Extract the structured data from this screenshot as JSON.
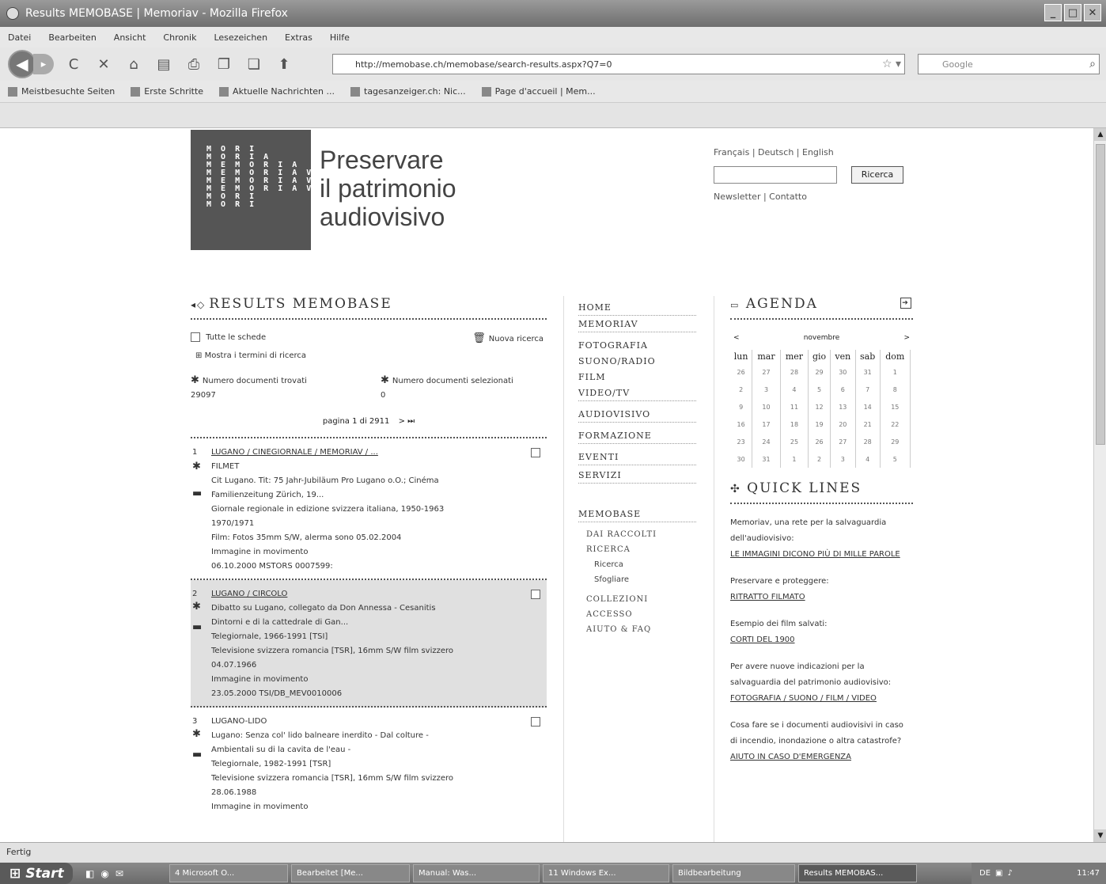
{
  "window": {
    "title": "Results MEMOBASE | Memoriav - Mozilla Firefox",
    "controls": [
      "_",
      "□",
      "✕"
    ]
  },
  "menubar": [
    "Datei",
    "Bearbeiten",
    "Ansicht",
    "Chronik",
    "Lesezeichen",
    "Extras",
    "Hilfe"
  ],
  "navbar": {
    "url": "http://memobase.ch/memobase/search-results.aspx?Q7=0",
    "search_placeholder": "Google"
  },
  "bookmarks": [
    {
      "label": "Meistbesuchte Seiten",
      "icon": "page-icon"
    },
    {
      "label": "Erste Schritte",
      "icon": "firefox-icon"
    },
    {
      "label": "Aktuelle Nachrichten ...",
      "icon": "rss-icon"
    },
    {
      "label": "tagesanzeiger.ch: Nic...",
      "icon": "c-icon"
    },
    {
      "label": "Page d'accueil | Mem...",
      "icon": "page-icon"
    }
  ],
  "header": {
    "logo_text": "M O R I\nM O R I A\nM E M O R I A\nM E M O R I A V\nM E M O R I A V\nM E M O R I A V\nM O R I\nM O R I",
    "tagline": [
      "Preservare",
      "il patrimonio",
      "audiovisivo"
    ],
    "languages": "Français | Deutsch | English",
    "search_button": "Ricerca",
    "links": "Newsletter | Contatto"
  },
  "results": {
    "heading": "RESULTS MEMOBASE",
    "select_all": "Tutte le schede",
    "new_search": "Nuova ricerca",
    "show_terms": "Mostra i termini di ricerca",
    "count_found_label": "Numero documenti trovati",
    "count_found": "29097",
    "count_selected_label": "Numero documenti selezionati",
    "count_selected": "0",
    "pager": "pagina 1 di 2911",
    "pager_next": "> ⏭",
    "items": [
      {
        "num": "1",
        "title": "LUGANO / CINEGIORNALE / MEMORIAV / ...",
        "lines": [
          "FILMET",
          "Cit Lugano. Tit: 75 Jahr-Jubiläum Pro Lugano o.O.; Cinéma",
          "Familienzeitung Zürich, 19...",
          "Giornale regionale in edizione svizzera italiana, 1950-1963",
          "1970/1971",
          "Film: Fotos 35mm S/W, alerma sono 05.02.2004",
          "Immagine in movimento",
          "06.10.2000  MSTORS 0007599:"
        ]
      },
      {
        "num": "2",
        "title": "LUGANO / CIRCOLO",
        "lines": [
          "Dibatto su Lugano, collegato da Don Annessa - Cesanitis",
          "Dintorni e di la cattedrale di Gan...",
          "Telegiornale, 1966-1991 [TSI]",
          "Televisione svizzera romancia [TSR], 16mm S/W film svizzero",
          "04.07.1966",
          "Immagine in movimento",
          "23.05.2000  TSI/DB_MEV0010006"
        ]
      },
      {
        "num": "3",
        "title": "LUGANO-LIDO",
        "lines": [
          "Lugano: Senza col' lido balneare inerdito - Dal colture -",
          "Ambientali su di la cavita de l'eau -",
          "Telegiornale, 1982-1991 [TSR]",
          "Televisione svizzera romancia [TSR], 16mm S/W film svizzero",
          "28.06.1988",
          "Immagine in movimento"
        ]
      }
    ]
  },
  "nav": {
    "items": [
      "HOME",
      "MEMORIAV",
      "FOTOGRAFIA",
      "SUONO/RADIO",
      "FILM",
      "VIDEO/TV",
      "AUDIOVISIVO",
      "FORMAZIONE",
      "EVENTI",
      "SERVIZI"
    ],
    "section": "MEMOBASE",
    "sub": [
      "DAI RACCOLTI",
      "RICERCA"
    ],
    "sub2": [
      "Ricerca",
      "Sfogliare"
    ],
    "sub3": [
      "COLLEZIONI",
      "ACCESSO",
      "AIUTO & FAQ"
    ]
  },
  "agenda": {
    "heading": "AGENDA",
    "month": "novembre",
    "prev": "<",
    "next": ">",
    "days": [
      "lun",
      "mar",
      "mer",
      "gio",
      "ven",
      "sab",
      "dom"
    ],
    "weeks": [
      [
        "26",
        "27",
        "28",
        "29",
        "30",
        "31",
        "1"
      ],
      [
        "2",
        "3",
        "4",
        "5",
        "6",
        "7",
        "8"
      ],
      [
        "9",
        "10",
        "11",
        "12",
        "13",
        "14",
        "15"
      ],
      [
        "16",
        "17",
        "18",
        "19",
        "20",
        "21",
        "22"
      ],
      [
        "23",
        "24",
        "25",
        "26",
        "27",
        "28",
        "29"
      ],
      [
        "30",
        "31",
        "1",
        "2",
        "3",
        "4",
        "5"
      ]
    ]
  },
  "quicklinks": {
    "heading": "QUICK LINES",
    "blocks": [
      {
        "text": "Memoriav, una rete per la salvaguardia dell'audiovisivo:",
        "link": "LE IMMAGINI DICONO PIÙ DI MILLE PAROLE"
      },
      {
        "text": "Preservare e proteggere:",
        "link": "RITRATTO FILMATO"
      },
      {
        "text": "Esempio dei film salvati:",
        "link": "CORTI DEL 1900"
      },
      {
        "text": "Per avere nuove indicazioni per la salvaguardia del patrimonio audiovisivo:",
        "link": "FOTOGRAFIA / SUONO / FILM / VIDEO"
      },
      {
        "text": "Cosa fare se i documenti audiovisivi in caso di incendio, inondazione o altra catastrofe?",
        "link": "AIUTO IN CASO D'EMERGENZA"
      }
    ]
  },
  "statusbar": "Fertig",
  "taskbar": {
    "start": "Start",
    "tasks": [
      "4 Microsoft O...",
      "Bearbeitet [Me...",
      "Manual: Was...",
      "11 Windows Ex...",
      "Bildbearbeitung",
      "Results MEMOBAS..."
    ],
    "clock": "11:47"
  }
}
